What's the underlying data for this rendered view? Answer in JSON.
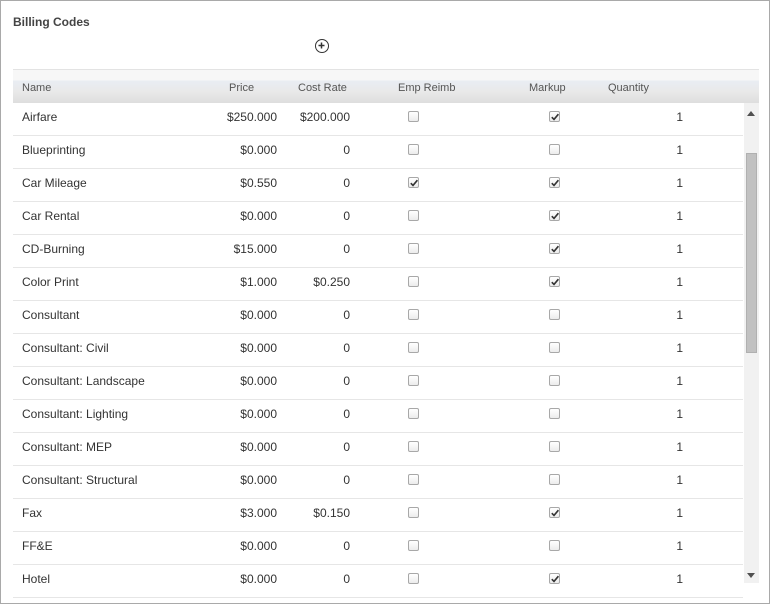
{
  "panel": {
    "title": "Billing Codes"
  },
  "toolbar": {
    "add_icon": "plus-circle-icon"
  },
  "columns": {
    "name": "Name",
    "price": "Price",
    "cost_rate": "Cost Rate",
    "emp_reimb": "Emp Reimb",
    "markup": "Markup",
    "quantity": "Quantity"
  },
  "rows": [
    {
      "name": "Airfare",
      "price": "$250.000",
      "cost_rate": "$200.000",
      "emp_reimb": false,
      "markup": true,
      "quantity": "1"
    },
    {
      "name": "Blueprinting",
      "price": "$0.000",
      "cost_rate": "0",
      "emp_reimb": false,
      "markup": false,
      "quantity": "1"
    },
    {
      "name": "Car Mileage",
      "price": "$0.550",
      "cost_rate": "0",
      "emp_reimb": true,
      "markup": true,
      "quantity": "1"
    },
    {
      "name": "Car Rental",
      "price": "$0.000",
      "cost_rate": "0",
      "emp_reimb": false,
      "markup": true,
      "quantity": "1"
    },
    {
      "name": "CD-Burning",
      "price": "$15.000",
      "cost_rate": "0",
      "emp_reimb": false,
      "markup": true,
      "quantity": "1"
    },
    {
      "name": "Color Print",
      "price": "$1.000",
      "cost_rate": "$0.250",
      "emp_reimb": false,
      "markup": true,
      "quantity": "1"
    },
    {
      "name": "Consultant",
      "price": "$0.000",
      "cost_rate": "0",
      "emp_reimb": false,
      "markup": false,
      "quantity": "1"
    },
    {
      "name": "Consultant: Civil",
      "price": "$0.000",
      "cost_rate": "0",
      "emp_reimb": false,
      "markup": false,
      "quantity": "1"
    },
    {
      "name": "Consultant: Landscape",
      "price": "$0.000",
      "cost_rate": "0",
      "emp_reimb": false,
      "markup": false,
      "quantity": "1"
    },
    {
      "name": "Consultant: Lighting",
      "price": "$0.000",
      "cost_rate": "0",
      "emp_reimb": false,
      "markup": false,
      "quantity": "1"
    },
    {
      "name": "Consultant: MEP",
      "price": "$0.000",
      "cost_rate": "0",
      "emp_reimb": false,
      "markup": false,
      "quantity": "1"
    },
    {
      "name": "Consultant: Structural",
      "price": "$0.000",
      "cost_rate": "0",
      "emp_reimb": false,
      "markup": false,
      "quantity": "1"
    },
    {
      "name": "Fax",
      "price": "$3.000",
      "cost_rate": "$0.150",
      "emp_reimb": false,
      "markup": true,
      "quantity": "1"
    },
    {
      "name": "FF&E",
      "price": "$0.000",
      "cost_rate": "0",
      "emp_reimb": false,
      "markup": false,
      "quantity": "1"
    },
    {
      "name": "Hotel",
      "price": "$0.000",
      "cost_rate": "0",
      "emp_reimb": false,
      "markup": true,
      "quantity": "1"
    }
  ]
}
